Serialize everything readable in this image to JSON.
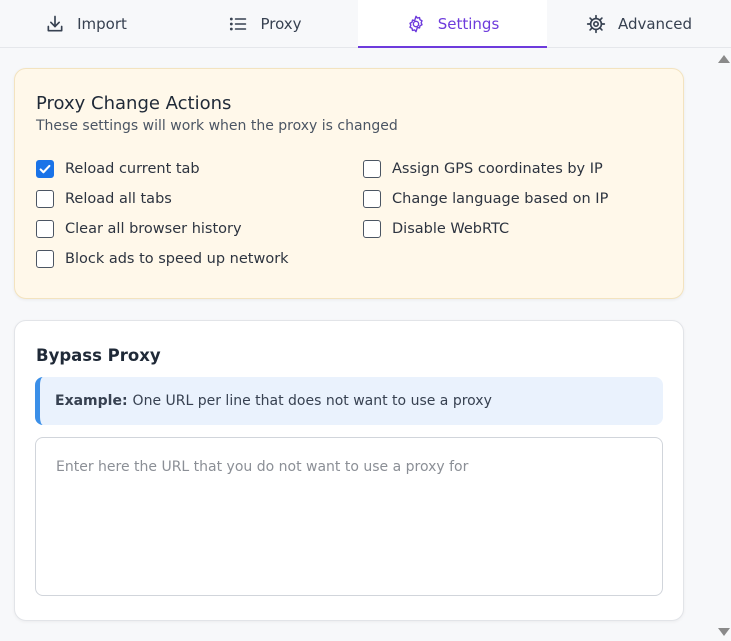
{
  "tabs": [
    {
      "label": "Import",
      "icon": "download-icon",
      "active": false
    },
    {
      "label": "Proxy",
      "icon": "list-icon",
      "active": false
    },
    {
      "label": "Settings",
      "icon": "gear-icon",
      "active": true
    },
    {
      "label": "Advanced",
      "icon": "cog-icon",
      "active": false
    }
  ],
  "proxy_change": {
    "title": "Proxy Change Actions",
    "subtitle": "These settings will work when the proxy is changed",
    "options": [
      {
        "label": "Reload current tab",
        "checked": true
      },
      {
        "label": "Reload all tabs",
        "checked": false
      },
      {
        "label": "Clear all browser history",
        "checked": false
      },
      {
        "label": "Block ads to speed up network",
        "checked": false
      },
      {
        "label": "Assign GPS coordinates by IP",
        "checked": false
      },
      {
        "label": "Change language based on IP",
        "checked": false
      },
      {
        "label": "Disable WebRTC",
        "checked": false
      }
    ]
  },
  "bypass": {
    "title": "Bypass Proxy",
    "example_label": "Example:",
    "example_text": "One URL per line that does not want to use a proxy",
    "placeholder": "Enter here the URL that you do not want to use a proxy for",
    "value": ""
  },
  "colors": {
    "accent": "#6d3bdc",
    "checkbox": "#1a73e8",
    "warn_card_bg": "#fff8ea",
    "info_bg": "#eaf2fd",
    "info_border": "#3b8fe8"
  }
}
